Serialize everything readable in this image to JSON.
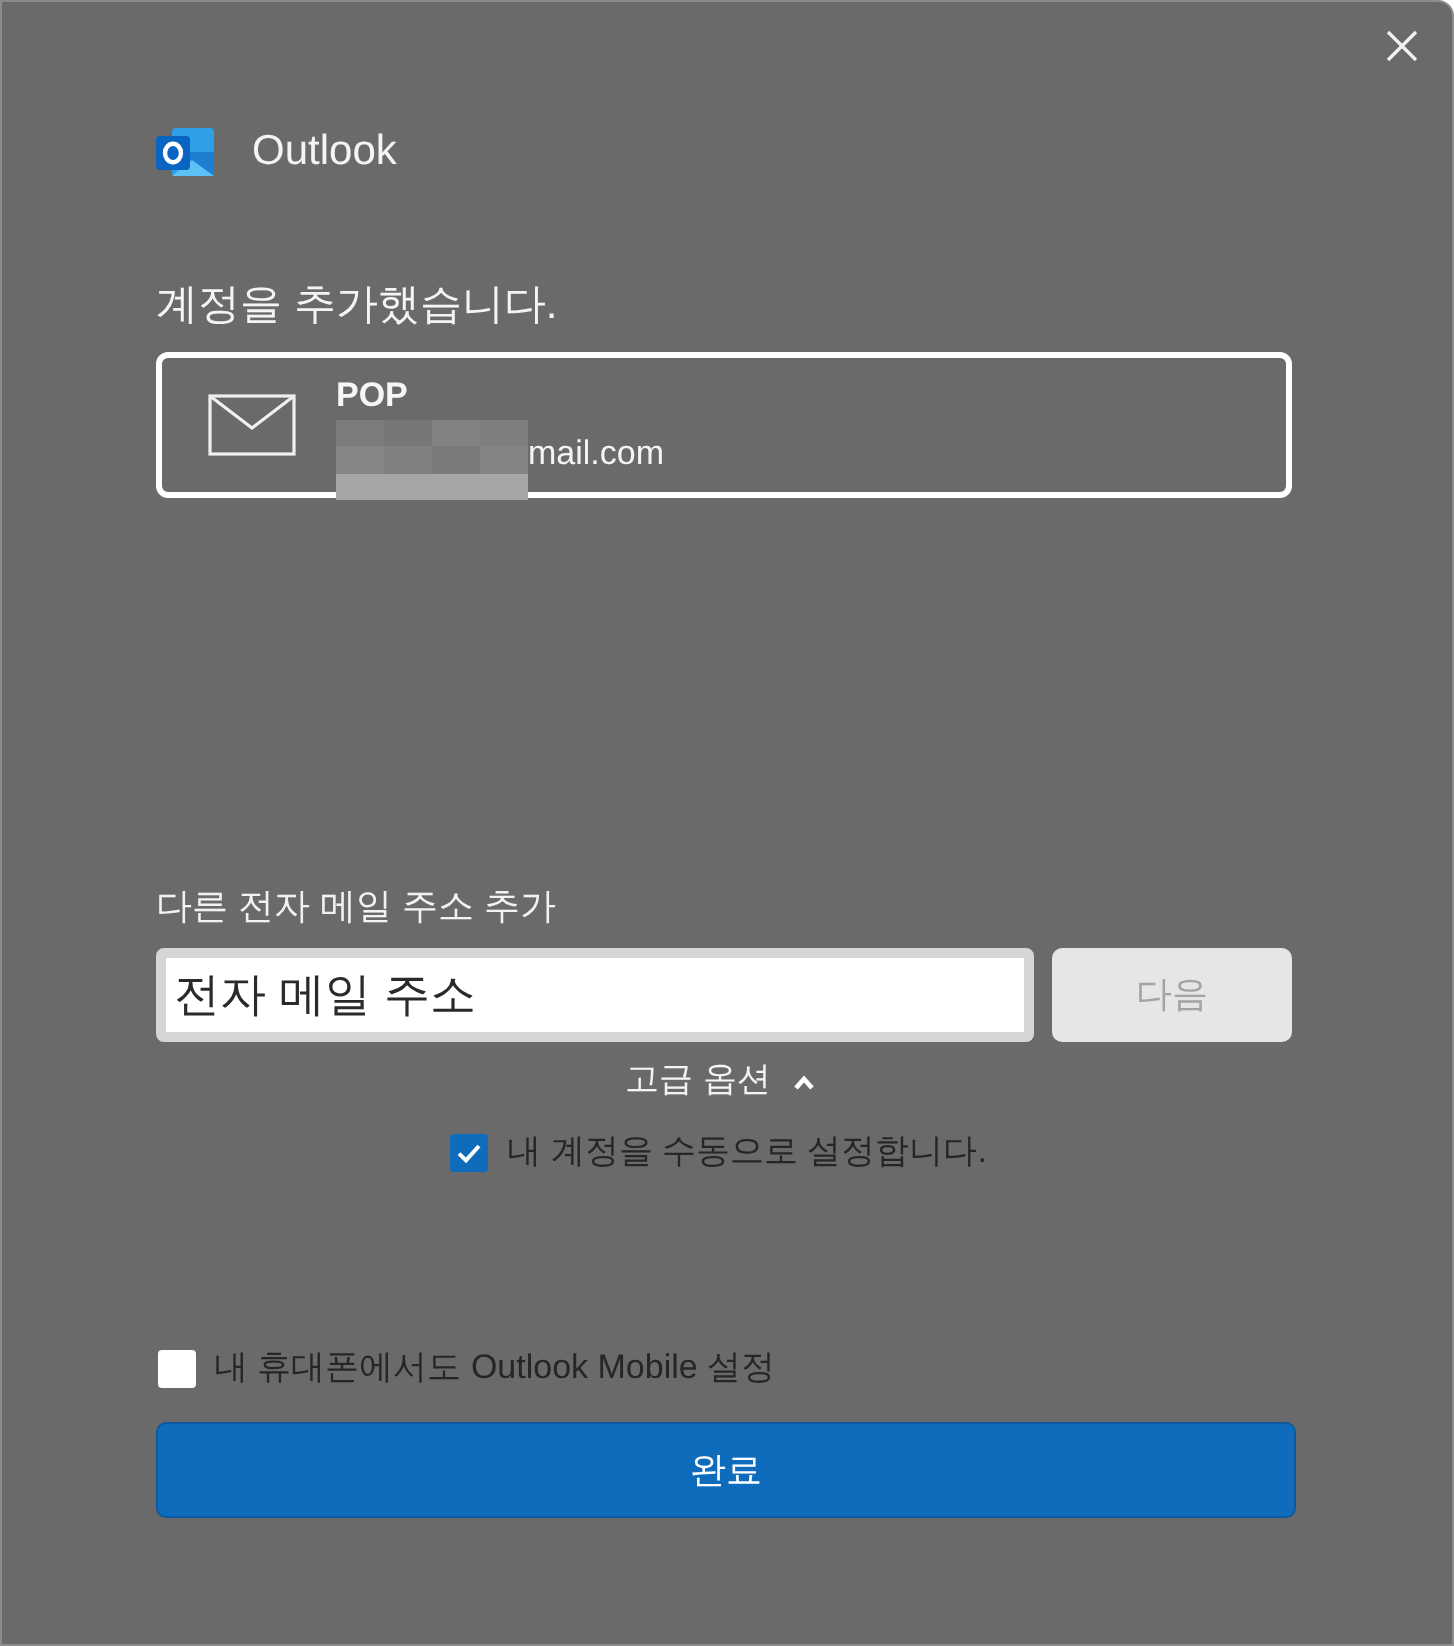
{
  "app": {
    "name": "Outlook"
  },
  "heading": "계정을 추가했습니다.",
  "accounts": [
    {
      "type": "POP",
      "email": "mail.com",
      "redacted": true
    }
  ],
  "add_email": {
    "label": "다른 전자 메일 주소 추가",
    "placeholder": "전자 메일 주소",
    "next_button": {
      "label": "다음",
      "disabled": true
    }
  },
  "advanced_options": {
    "label": "고급 옵션",
    "expanded": true,
    "options": [
      {
        "label": "내 계정을 수동으로 설정합니다.",
        "checked": true
      }
    ]
  },
  "mobile_setup": {
    "label": "내 휴대폰에서도 Outlook Mobile 설정",
    "checked": false
  },
  "done_button": {
    "label": "완료"
  }
}
